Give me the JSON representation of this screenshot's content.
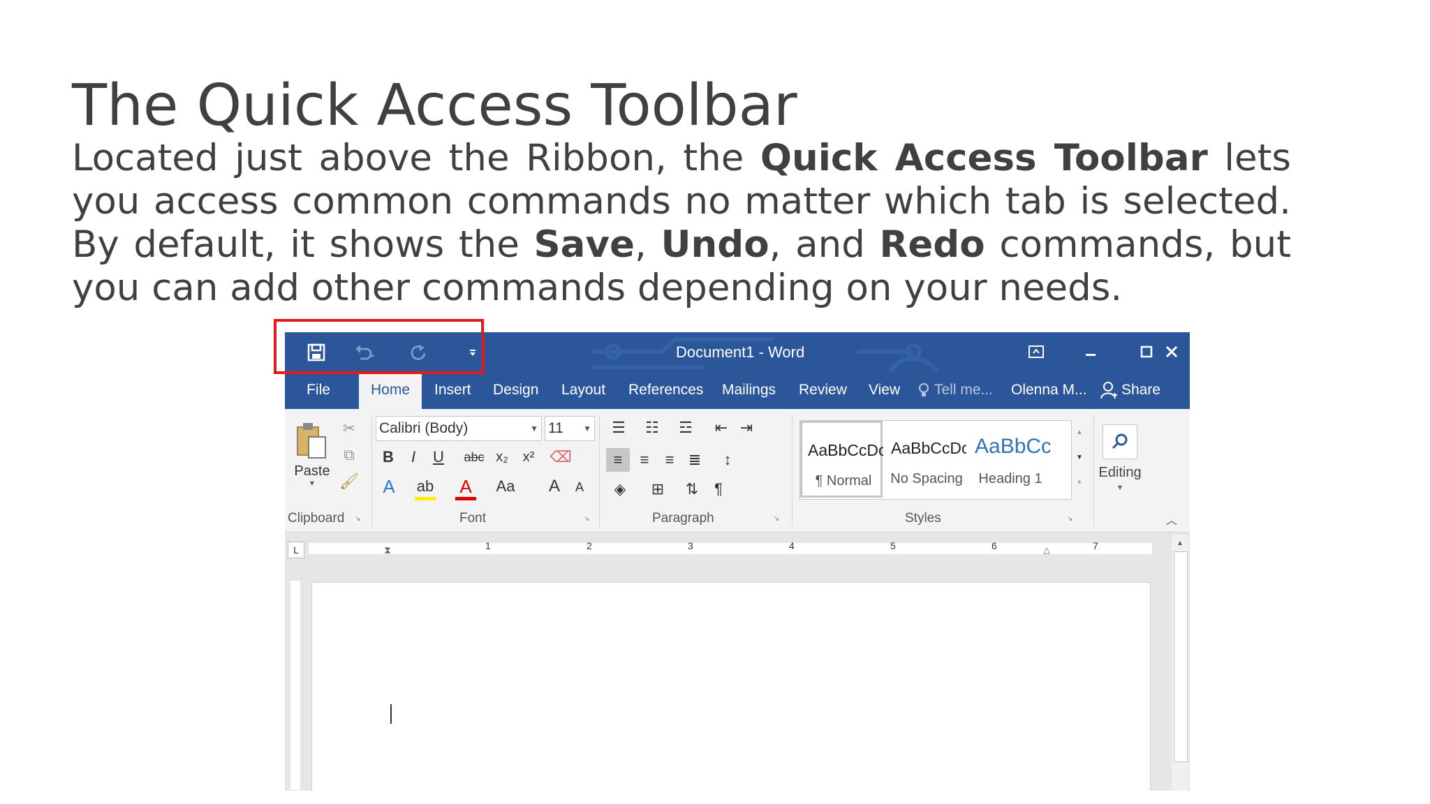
{
  "slide": {
    "title": "The Quick Access Toolbar",
    "body": {
      "p1": "Located just above the Ribbon, the ",
      "b1": "Quick Access Toolbar",
      "p2": " lets you access common commands no matter which tab is selected. By default, it shows the ",
      "b2": "Save",
      "p3": ", ",
      "b3": "Undo",
      "p4": ", and ",
      "b4": "Redo",
      "p5": " commands, but you can add other commands depending on your needs."
    }
  },
  "word": {
    "title": "Document1 - Word",
    "colors": {
      "accent": "#2b579a",
      "ribbon_bg": "#f3f3f3",
      "highlight": "#e21a1a"
    },
    "qat": {
      "save_icon": "save-icon",
      "undo_icon": "undo-icon",
      "redo_icon": "redo-icon",
      "customize_icon": "customize-qat-icon"
    },
    "window_controls": [
      "ribbon-display-options-icon",
      "minimize-icon",
      "maximize-icon",
      "close-icon"
    ],
    "tabs": {
      "file": "File",
      "home": "Home",
      "insert": "Insert",
      "design": "Design",
      "layout": "Layout",
      "references": "References",
      "mailings": "Mailings",
      "review": "Review",
      "view": "View",
      "tell_me": "Tell me...",
      "user": "Olenna M...",
      "share": "Share"
    },
    "ribbon": {
      "clipboard": {
        "label": "Clipboard",
        "paste": "Paste"
      },
      "font": {
        "label": "Font",
        "font_name": "Calibri (Body)",
        "font_size": "11",
        "bold": "B",
        "italic": "I",
        "underline": "U",
        "strikethrough": "abc",
        "subscript": "x₂",
        "superscript": "x²",
        "change_case": "Aa",
        "grow_font": "A",
        "shrink_font": "A"
      },
      "paragraph": {
        "label": "Paragraph",
        "pilcrow": "¶"
      },
      "styles": {
        "label": "Styles",
        "items": [
          {
            "sample": "AaBbCcDc",
            "name": "¶ Normal"
          },
          {
            "sample": "AaBbCcDc",
            "name": "No Spacing"
          },
          {
            "sample": "AaBbCc",
            "name": "Heading 1"
          }
        ]
      },
      "editing": {
        "label": "Editing"
      }
    },
    "ruler": {
      "numbers": [
        "1",
        "2",
        "3",
        "4",
        "5",
        "6",
        "7"
      ]
    }
  }
}
